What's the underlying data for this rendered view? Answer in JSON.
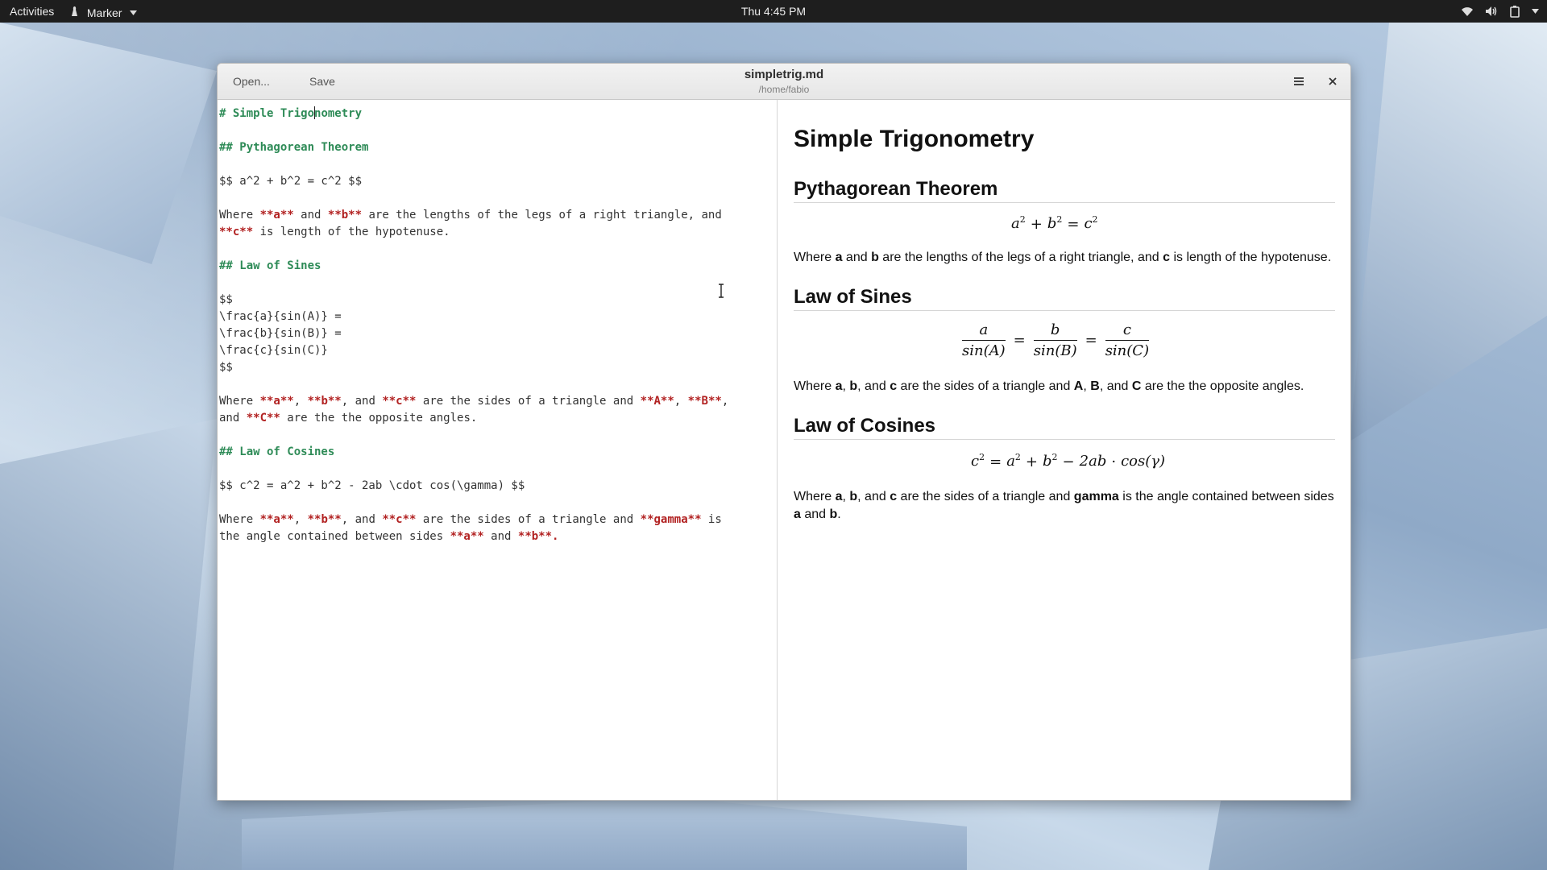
{
  "topbar": {
    "activities": "Activities",
    "app_menu": "Marker",
    "clock": "Thu  4:45 PM"
  },
  "window": {
    "open_label": "Open...",
    "save_label": "Save",
    "title": "simpletrig.md",
    "subtitle": "/home/fabio"
  },
  "editor": {
    "h1": "# Simple Trigonometry",
    "h1_before_cursor": "# Simple Trigo",
    "h1_after_cursor": "nometry",
    "h2_pyth": "## Pythagorean Theorem",
    "pyth_math": "$$ a^2 + b^2 = c^2 $$",
    "h2_sines": "## Law of Sines",
    "sines_math": [
      "$$",
      "\\frac{a}{sin(A)} =",
      "\\frac{b}{sin(B)} =",
      "\\frac{c}{sin(C)}",
      "$$"
    ],
    "h2_cosines": "## Law of Cosines",
    "cosines_math": "$$ c^2 = a^2 + b^2 - 2ab \\cdot cos(\\gamma) $$",
    "tokens": {
      "where": "Where ",
      "and": " and ",
      "comma": ", ",
      "comma_and": ", and ",
      "a": "**a**",
      "b": "**b**",
      "c": "**c**",
      "A": "**A**",
      "B": "**B**",
      "C": "**C**",
      "gamma": "**gamma**",
      "p1_rest": " are the lengths of the legs of a right triangle, and",
      "p1_line2": " is length of the hypotenuse.",
      "p2_mid": " are the sides of a triangle and ",
      "p2_line2_start": "and ",
      "p2_end": " are the the opposite angles.",
      "p3_end": " is",
      "p3_line2_start": "the angle contained between sides ",
      "period": "."
    }
  },
  "preview": {
    "h1": "Simple Trigonometry",
    "h2_pyth": "Pythagorean Theorem",
    "h2_sines": "Law of Sines",
    "h2_cosines": "Law of Cosines",
    "w": {
      "where": "Where ",
      "and": " and ",
      "comma": ", ",
      "comma_and": ", and ",
      "a": "a",
      "b": "b",
      "c": "c",
      "A": "A",
      "B": "B",
      "C": "C",
      "gamma": "gamma",
      "p1_rest": " are the lengths of the legs of a right triangle, and ",
      "p1_end": " is length of the hypotenuse.",
      "p2_mid": " are the sides of a triangle and ",
      "p2_end": " are the the opposite angles.",
      "p3_end": " is the angle contained between sides ",
      "period": "."
    },
    "math": {
      "a": "a",
      "b": "b",
      "c": "c",
      "two": "2",
      "plus": "+",
      "eq": "=",
      "minus": "−",
      "sinA": "sin(A)",
      "sinB": "sin(B)",
      "sinC": "sin(C)",
      "two_ab": "2ab",
      "cdot": "·",
      "cos_gamma": "cos(γ)"
    }
  },
  "colors": {
    "heading": "#2e8b57",
    "bold": "#b22222",
    "topbar": "#1e1e1e"
  }
}
